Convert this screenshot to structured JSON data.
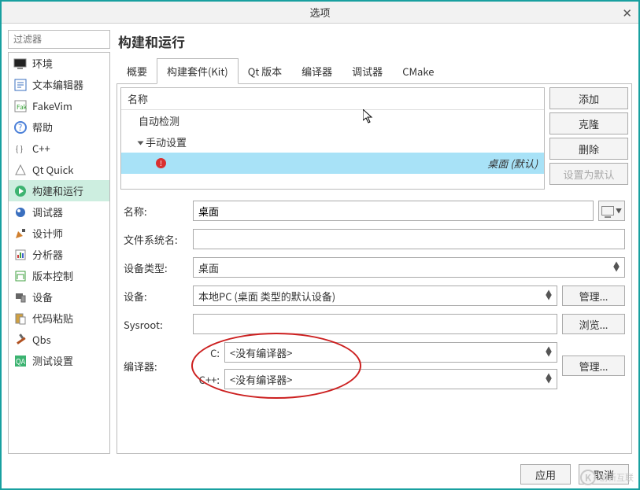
{
  "window": {
    "title": "选项",
    "close_tooltip": "关闭"
  },
  "filter": {
    "placeholder": "过滤器"
  },
  "categories": [
    {
      "id": "env",
      "label": "环境"
    },
    {
      "id": "text",
      "label": "文本编辑器"
    },
    {
      "id": "fakevim",
      "label": "FakeVim"
    },
    {
      "id": "help",
      "label": "帮助"
    },
    {
      "id": "cpp",
      "label": "C++"
    },
    {
      "id": "qtquick",
      "label": "Qt Quick"
    },
    {
      "id": "build",
      "label": "构建和运行"
    },
    {
      "id": "debugger",
      "label": "调试器"
    },
    {
      "id": "designer",
      "label": "设计师"
    },
    {
      "id": "analyzer",
      "label": "分析器"
    },
    {
      "id": "vcs",
      "label": "版本控制"
    },
    {
      "id": "devices",
      "label": "设备"
    },
    {
      "id": "paste",
      "label": "代码粘贴"
    },
    {
      "id": "qbs",
      "label": "Qbs"
    },
    {
      "id": "qa",
      "label": "测试设置"
    }
  ],
  "page_title": "构建和运行",
  "tabs": [
    {
      "id": "overview",
      "label": "概要"
    },
    {
      "id": "kits",
      "label": "构建套件(Kit)"
    },
    {
      "id": "qtver",
      "label": "Qt 版本"
    },
    {
      "id": "compilers",
      "label": "编译器"
    },
    {
      "id": "debuggers",
      "label": "调试器"
    },
    {
      "id": "cmake",
      "label": "CMake"
    }
  ],
  "tree": {
    "header": "名称",
    "auto_group": "自动检测",
    "manual_group": "手动设置",
    "item": "桌面 (默认)"
  },
  "buttons": {
    "add": "添加",
    "clone": "克隆",
    "delete": "删除",
    "setdefault": "设置为默认",
    "manage": "管理...",
    "browse": "浏览...",
    "apply": "应用",
    "cancel": "取消"
  },
  "form": {
    "name_label": "名称:",
    "name_value": "桌面",
    "fsname_label": "文件系统名:",
    "fsname_value": "",
    "devtype_label": "设备类型:",
    "devtype_value": "桌面",
    "device_label": "设备:",
    "device_value": "本地PC (桌面 类型的默认设备)",
    "sysroot_label": "Sysroot:",
    "sysroot_value": "",
    "compilers_label": "编译器:",
    "c_label": "C:",
    "c_value": "<没有编译器>",
    "cxx_label": "C++:",
    "cxx_value": "<没有编译器>"
  },
  "brand": {
    "text": "创新互联"
  }
}
